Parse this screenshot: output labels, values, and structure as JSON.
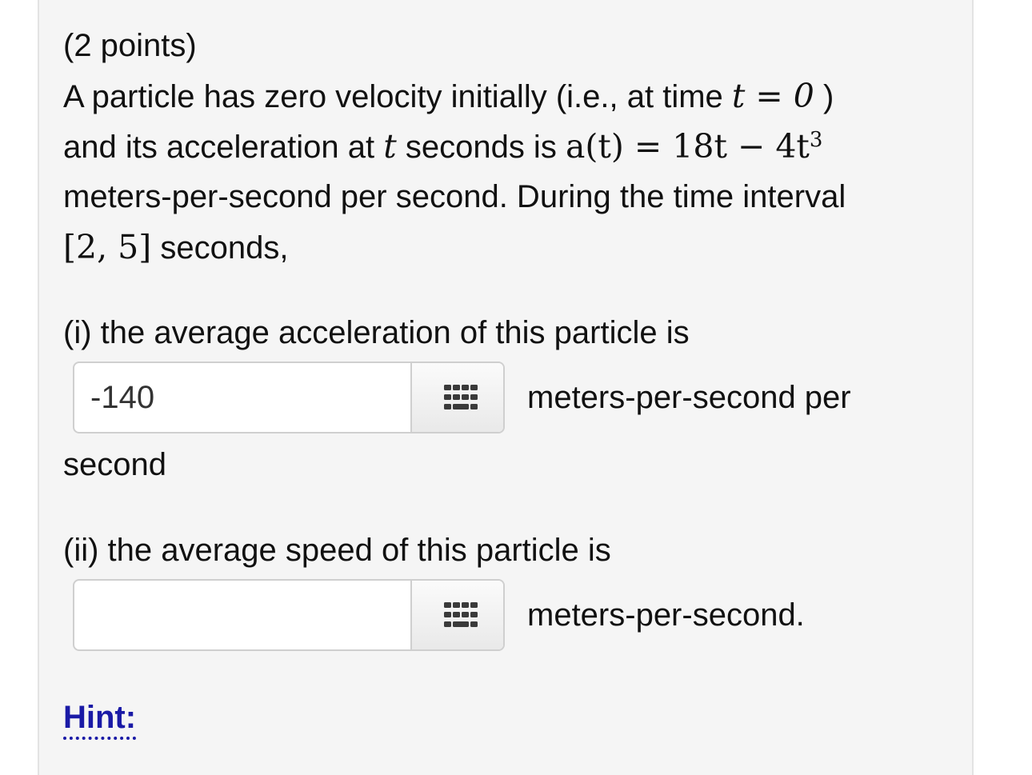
{
  "problem": {
    "points": "(2 points)",
    "line1_text": "A particle has zero velocity initially (i.e., at time ",
    "line1_math": "t = 0",
    "line1_end": " )",
    "line2_text_a": "and its acceleration at ",
    "line2_math_t": "t",
    "line2_text_b": " seconds is ",
    "line2_math_expr_lhs": "a(t) = 18t − 4t",
    "line2_math_exp": "3",
    "line3_text": "meters-per-second per second. During the time interval",
    "line4_math": "[2, 5]",
    "line4_text": " seconds,"
  },
  "part_i": {
    "prompt": "(i) the average acceleration of this particle is",
    "input_value": "-140",
    "unit_inline": "meters-per-second per",
    "unit_wrap": "second"
  },
  "part_ii": {
    "prompt": "(ii) the average speed of this particle is",
    "input_value": "",
    "unit": "meters-per-second."
  },
  "hint": {
    "label": "Hint:"
  },
  "icons": {
    "keyboard_button": "keyboard-grid-icon"
  },
  "colors": {
    "panel_bg": "#f5f5f5",
    "hint_link": "#1a1aa6"
  }
}
